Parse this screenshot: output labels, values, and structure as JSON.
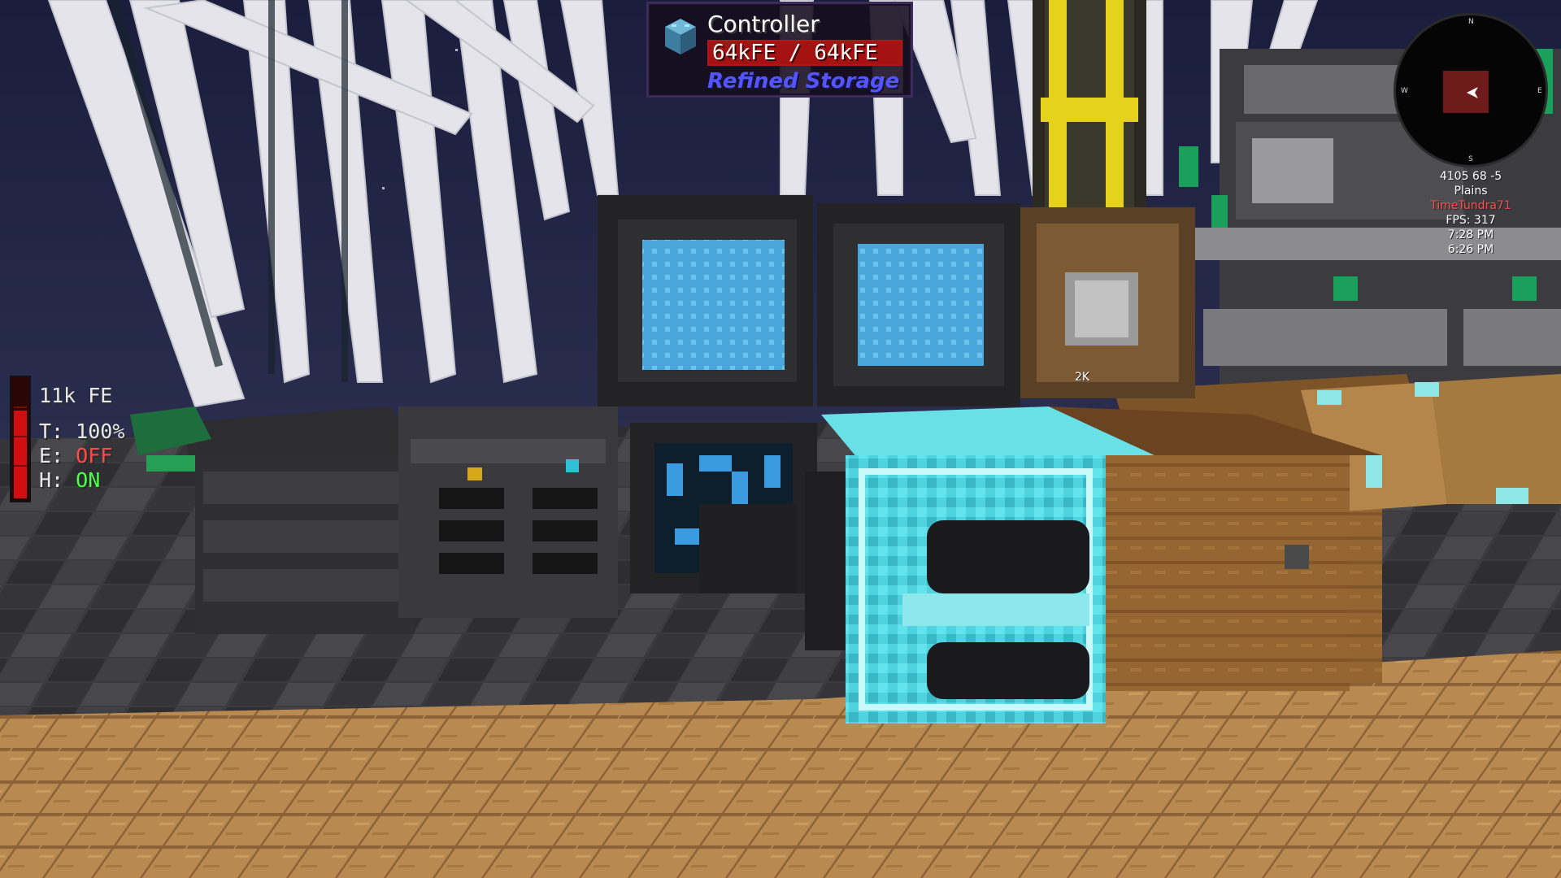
{
  "tooltip": {
    "block_name": "Controller",
    "energy_text": "64kFE / 64kFE",
    "energy_fraction": 1.0,
    "mod_name": "Refined Storage",
    "icon": "controller-block-icon"
  },
  "minimap": {
    "compass": {
      "n": "N",
      "s": "S",
      "e": "E",
      "w": "W"
    },
    "coords": "4105 68 -5",
    "biome": "Plains",
    "player": "TimeTundra71",
    "fps": "FPS: 317",
    "game_time": "7:28 PM",
    "real_time": "6:26 PM"
  },
  "energy_hud": {
    "stored": "11k FE",
    "temp_label": "T:",
    "temp_value": "100%",
    "e_label": "E:",
    "e_value": "OFF",
    "h_label": "H:",
    "h_value": "ON",
    "fill_fraction": 0.75
  },
  "world": {
    "disk_drive_label": "2K"
  },
  "colors": {
    "tooltip_bg": "#160c1e",
    "tooltip_border": "#3b2a5a",
    "energy_red": "#a41212",
    "mod_blue": "#5555ff",
    "diamond": "#4fd3de",
    "wood": "#a7773f"
  }
}
